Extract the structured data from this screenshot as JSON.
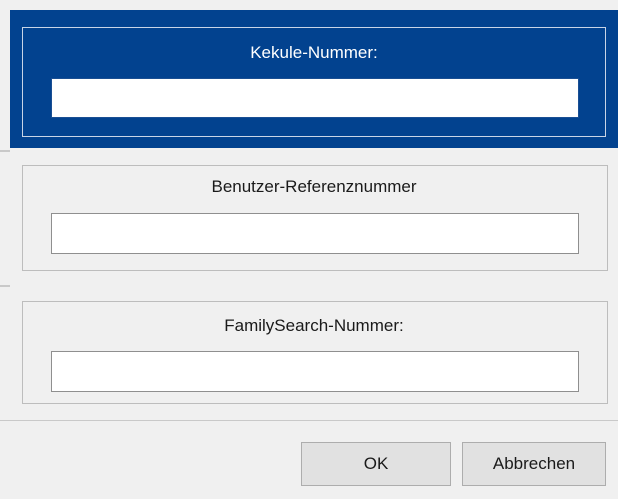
{
  "kekule": {
    "label": "Kekule-Nummer:",
    "value": ""
  },
  "user_reference": {
    "label": "Benutzer-Referenznummer",
    "value": ""
  },
  "familysearch": {
    "label": "FamilySearch-Nummer:",
    "value": ""
  },
  "buttons": {
    "ok_label": "OK",
    "cancel_label": "Abbrechen"
  },
  "colors": {
    "selected_background": "#02428f",
    "dialog_background": "#f0f0f0"
  }
}
